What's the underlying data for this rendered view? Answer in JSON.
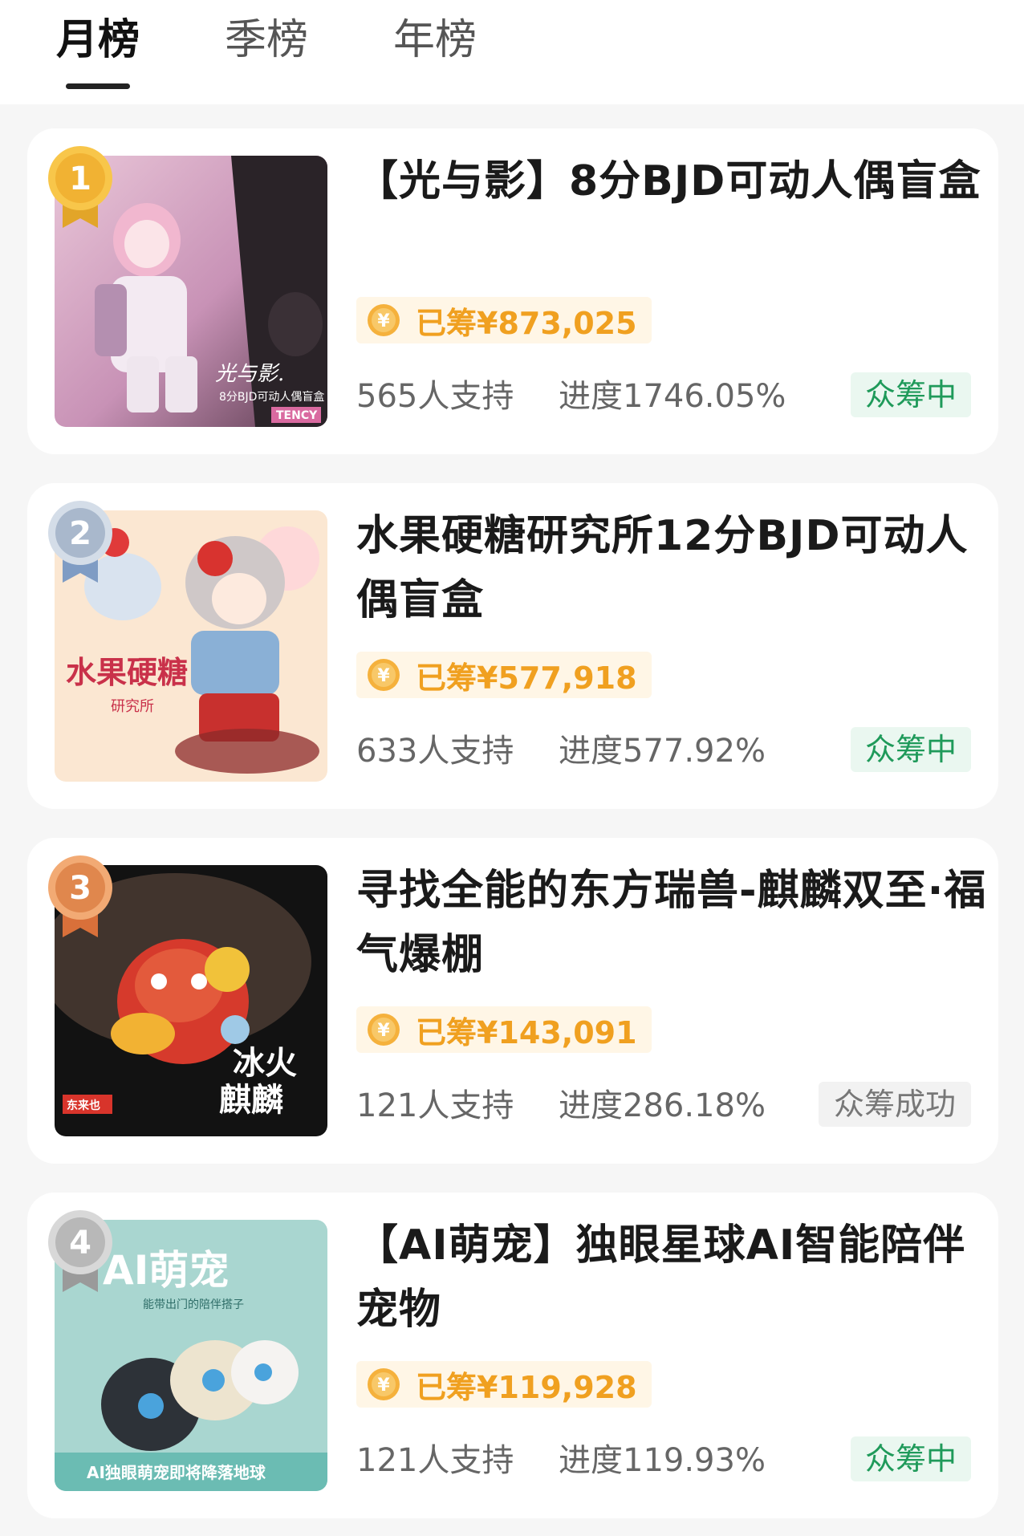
{
  "tabs": [
    {
      "label": "月榜",
      "active": true
    },
    {
      "label": "季榜",
      "active": false
    },
    {
      "label": "年榜",
      "active": false
    }
  ],
  "colors": {
    "accent_orange": "#f0a020",
    "status_active": "#1f9a5a",
    "status_done": "#777777"
  },
  "items": [
    {
      "rank": "1",
      "medal": "gold",
      "title": "【光与影】8分BJD可动人偶盲盒",
      "raised": "已筹¥873,025",
      "supporters": "565人支持",
      "progress": "进度1746.05%",
      "status": "众筹中",
      "thumb_text": [
        "光与影.",
        "8分BJD可动人偶盲盒",
        "TENCY"
      ]
    },
    {
      "rank": "2",
      "medal": "silver",
      "title": "水果硬糖研究所12分BJD可动人偶盲盒",
      "raised": "已筹¥577,918",
      "supporters": "633人支持",
      "progress": "进度577.92%",
      "status": "众筹中",
      "thumb_text": [
        "水果硬糖",
        "研究所"
      ]
    },
    {
      "rank": "3",
      "medal": "bronze",
      "title": "寻找全能的东方瑞兽-麒麟双至·福气爆棚",
      "raised": "已筹¥143,091",
      "supporters": "121人支持",
      "progress": "进度286.18%",
      "status": "众筹成功",
      "thumb_text": [
        "冰火",
        "麒麟",
        "东来也"
      ]
    },
    {
      "rank": "4",
      "medal": "gray",
      "title": "【AI萌宠】独眼星球AI智能陪伴宠物",
      "raised": "已筹¥119,928",
      "supporters": "121人支持",
      "progress": "进度119.93%",
      "status": "众筹中",
      "thumb_text": [
        "AI萌宠",
        "能带出门的陪伴搭子",
        "AI独眼萌宠即将降落地球"
      ]
    }
  ]
}
